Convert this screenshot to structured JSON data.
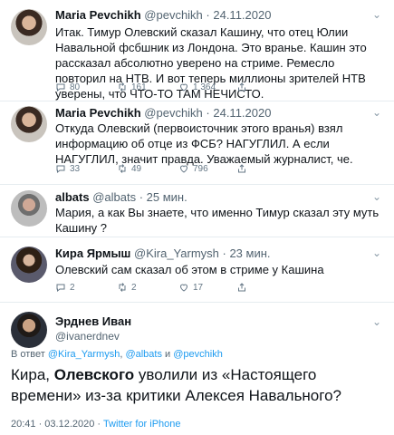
{
  "tweets": [
    {
      "name": "Maria Pevchikh",
      "handle": "@pevchikh",
      "date": "· 24.11.2020",
      "text": "Итак. Тимур Олевский сказал Кашину, что отец Юлии Навальной фсбшник из Лондона. Это вранье. Кашин это рассказал абсолютно уверено на стриме. Ремесло повторил на НТВ. И вот теперь миллионы зрителей НТВ уверены, что ЧТО-ТО ТАМ НЕЧИСТО.",
      "replies": "80",
      "retweets": "161",
      "likes": "1 364"
    },
    {
      "name": "Maria Pevchikh",
      "handle": "@pevchikh",
      "date": "· 24.11.2020",
      "text": "Откуда Олевский (первоисточник этого вранья) взял информацию об отце из ФСБ? НАГУГЛИЛ. А если НАГУГЛИЛ, значит правда. Уважаемый журналист, че.",
      "replies": "33",
      "retweets": "49",
      "likes": "796"
    },
    {
      "name": "albats",
      "handle": "@albats",
      "date": "· 25 мин.",
      "text": "Мария, а как Вы знаете, что именно Тимур сказал эту муть Кашину ?",
      "replies": "",
      "retweets": "",
      "likes": ""
    },
    {
      "name": "Кира Ярмыш",
      "handle": "@Kira_Yarmysh",
      "date": "· 23 мин.",
      "text": "Олевский сам сказал об этом в стриме у Кашина",
      "replies": "2",
      "retweets": "2",
      "likes": "17"
    }
  ],
  "main": {
    "name": "Эрднев Иван",
    "handle": "@ivanerdnev",
    "reply_prefix": "В ответ",
    "mention1": "@Kira_Yarmysh",
    "sep1": ",",
    "mention2": "@albats",
    "and_word": "и",
    "mention3": "@pevchikh",
    "text_before": "Кира, ",
    "text_bold": "Олевского",
    "text_after": " уволили из «Настоящего времени» из-за критики Алексея Навального?",
    "time": "20:41 · 03.12.2020 ·",
    "client": "Twitter for iPhone"
  },
  "icons": [
    "reply-icon",
    "retweet-icon",
    "like-icon",
    "share-icon",
    "chevron-down-icon"
  ],
  "colors": {
    "link": "#1d9bf0",
    "secondary": "#536471",
    "text": "#0f1419"
  }
}
